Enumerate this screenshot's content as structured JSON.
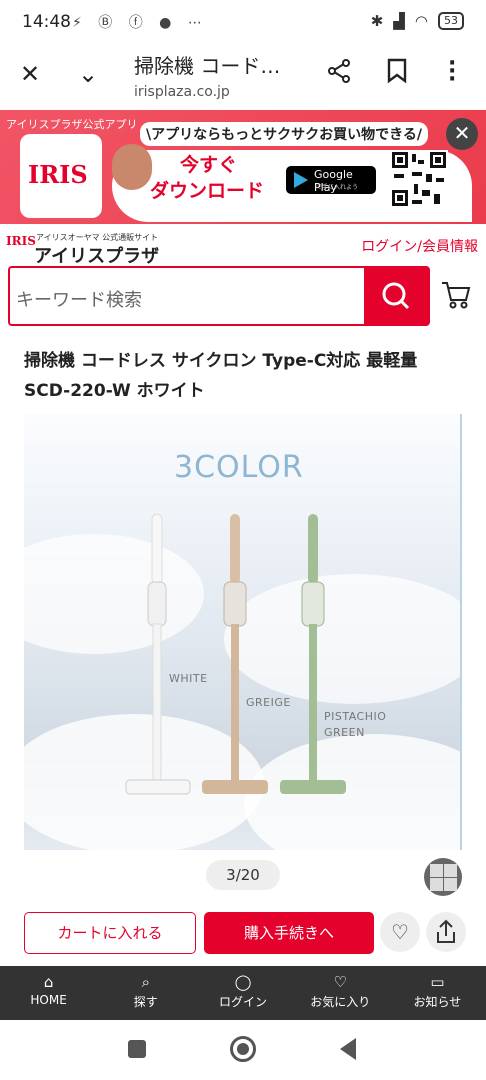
{
  "status": {
    "time": "14:48",
    "battery": "53"
  },
  "browser": {
    "title": "掃除機 コード…",
    "url": "irisplaza.co.jp"
  },
  "banner": {
    "tag": "アイリスプラザ公式アプリ",
    "logo": "IRIS",
    "headline": "\\アプリならもっとサクサクお買い物できる/",
    "now": "今すぐ",
    "download": "ダウンロード",
    "gplay_title": "Google Play",
    "gplay_sub": "で手に入れよう"
  },
  "site": {
    "sub": "アイリスオーヤマ 公式通販サイト",
    "logo_text": "アイリスプラザ",
    "login": "ログイン/会員情報"
  },
  "search": {
    "placeholder": "キーワード検索"
  },
  "product": {
    "title": "掃除機 コードレス サイクロン Type-C対応 最軽量 SCD-220-W ホワイト",
    "hero_title": "3COLOR",
    "colors": [
      "WHITE",
      "GREIGE",
      "PISTACHIO",
      "GREEN"
    ],
    "pager": "3/20"
  },
  "actions": {
    "cart": "カートに入れる",
    "buy": "購入手続きへ"
  },
  "nav": [
    {
      "icon": "home-icon",
      "label": "HOME"
    },
    {
      "icon": "search-icon",
      "label": "探す"
    },
    {
      "icon": "user-icon",
      "label": "ログイン"
    },
    {
      "icon": "heart-icon",
      "label": "お気に入り"
    },
    {
      "icon": "bell-icon",
      "label": "お知らせ"
    }
  ],
  "colors": {
    "brand_red": "#e4022d",
    "nav_bg": "#333333"
  }
}
